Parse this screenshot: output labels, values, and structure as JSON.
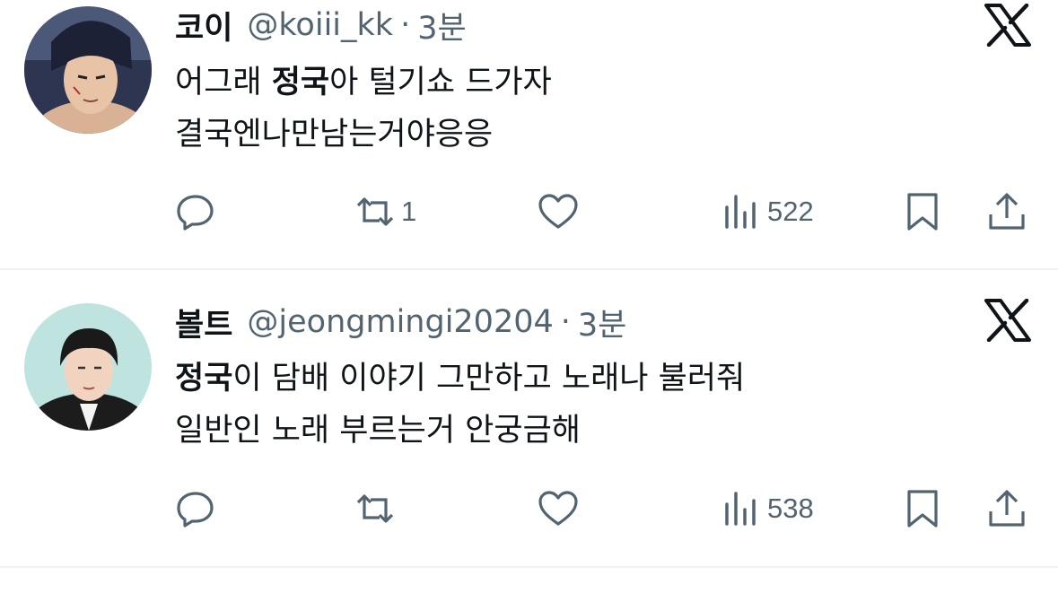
{
  "tweets": [
    {
      "display_name": "코이",
      "handle": "@koiii_kk",
      "separator": "·",
      "time": "3분",
      "text_line1_prefix": "어그래 ",
      "text_line1_bold": "정국",
      "text_line1_suffix": "아 털기쇼 드가자",
      "text_line2": "결국엔나만남는거야응응",
      "actions": {
        "reply_count": "",
        "retweet_count": "1",
        "like_count": "",
        "views_count": "522"
      },
      "avatar_colors": {
        "bg": "#5a6a86",
        "hair": "#1d2135",
        "skin": "#e8c3a6"
      }
    },
    {
      "display_name": "볼트",
      "handle": "@jeongmingi20204",
      "separator": "·",
      "time": "3분",
      "text_line1_prefix": "",
      "text_line1_bold": "정국",
      "text_line1_suffix": "이 담배 이야기 그만하고 노래나 불러줘",
      "text_line2": "일반인 노래 부르는거 안궁금해",
      "actions": {
        "reply_count": "",
        "retweet_count": "",
        "like_count": "",
        "views_count": "538"
      },
      "avatar_colors": {
        "bg": "#bfe4df",
        "hair": "#1a1a1a",
        "skin": "#f1d3c0"
      }
    }
  ],
  "colors": {
    "text_primary": "#0f1419",
    "text_secondary": "#536471",
    "divider": "#eff3f4"
  },
  "icons": [
    "reply-icon",
    "retweet-icon",
    "like-icon",
    "views-icon",
    "bookmark-icon",
    "share-icon",
    "x-logo-icon"
  ]
}
